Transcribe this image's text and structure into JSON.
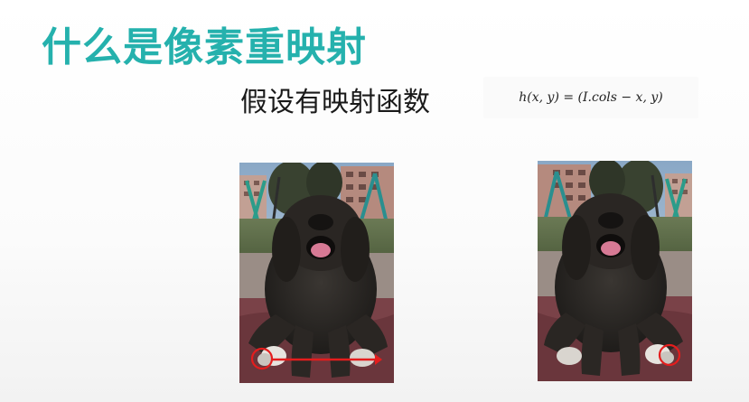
{
  "slide": {
    "title": "什么是像素重映射",
    "subtitle": "假设有映射函数",
    "formula": "h(x, y) = (I.cols − x, y)"
  },
  "images": {
    "original": {
      "icon": "dog-photo-original",
      "highlight": "red-circle-left-paw",
      "arrow": "red-arrow-right"
    },
    "mirrored": {
      "icon": "dog-photo-mirrored",
      "highlight": "red-circle-right-paw"
    }
  },
  "colors": {
    "title": "#25b1ad",
    "highlight": "#e41d1d"
  }
}
